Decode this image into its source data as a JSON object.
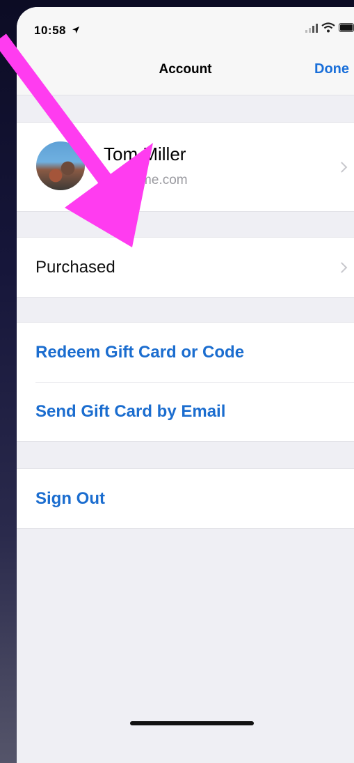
{
  "status_bar": {
    "time": "10:58",
    "location_icon": "location-arrow-icon",
    "signal_icon": "cellular-signal-icon",
    "wifi_icon": "wifi-icon",
    "battery_icon": "battery-icon"
  },
  "nav": {
    "title": "Account",
    "done_label": "Done"
  },
  "profile": {
    "name": "Tom Miller",
    "email": "tmill@me.com"
  },
  "rows": {
    "purchased": "Purchased",
    "redeem": "Redeem Gift Card or Code",
    "send_gift": "Send Gift Card by Email",
    "sign_out": "Sign Out"
  },
  "colors": {
    "accent": "#1b6dcf",
    "annotation_arrow": "#ff3cf0",
    "background": "#efeff4"
  }
}
